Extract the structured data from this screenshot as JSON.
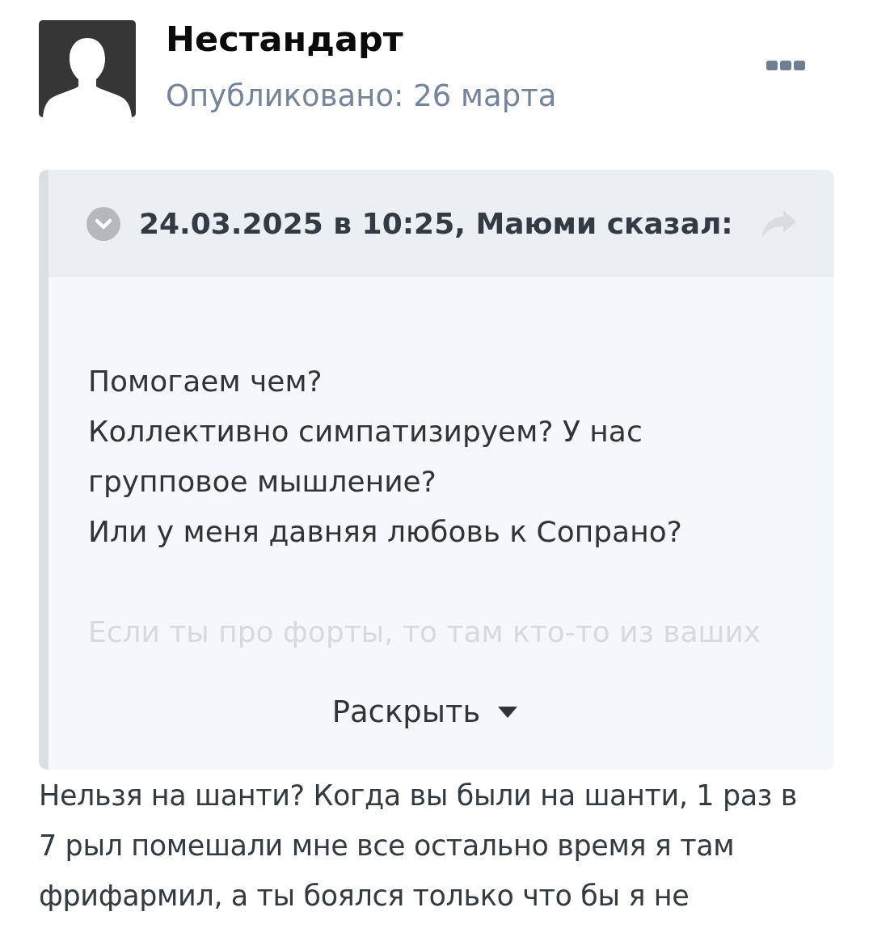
{
  "post": {
    "author": "Нестандарт",
    "published": "Опубликовано: 26 марта"
  },
  "quote": {
    "header": "24.03.2025 в 10:25, Маюми сказал:",
    "expanded": false,
    "lines": [
      "Помогаем чем?",
      "Коллективно симпатизируем? У нас групповое мышление?",
      "Или у меня давняя любовь к Сопрано?"
    ],
    "cut_line": "Если ты про форты, то там кто-то из ваших",
    "expand_label": "Раскрыть"
  },
  "body": "Нельзя на шанти? Когда вы были на шанти, 1 раз в 7 рыл помешали мне все остально время я там фрифармил, а ты боялся только что бы я не"
}
